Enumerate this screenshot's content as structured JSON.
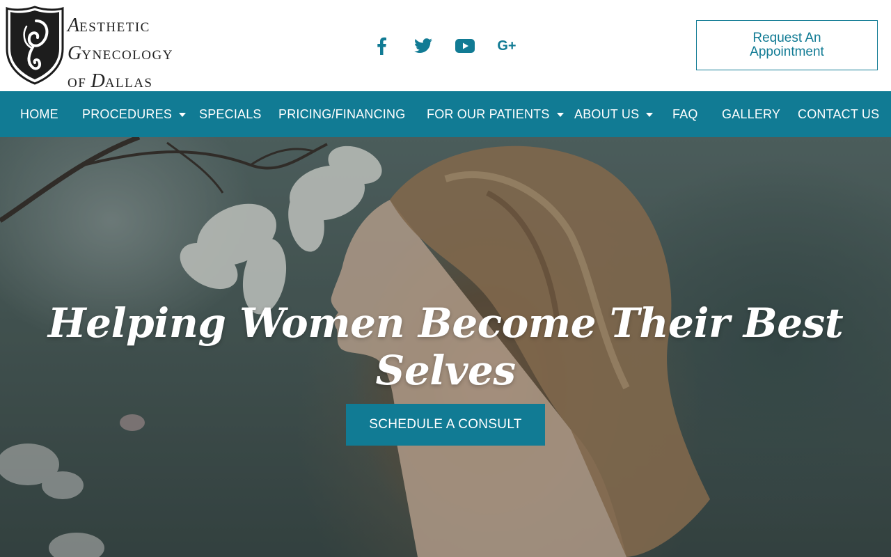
{
  "brand": {
    "logo": {
      "line1_cap": "A",
      "line1_rest": "ESTHETIC",
      "line2_cap": "G",
      "line2_rest": "YNECOLOGY",
      "line3_pre": "OF ",
      "line3_cap": "D",
      "line3_rest": "ALLAS"
    },
    "accent_color": "#117b94"
  },
  "social": [
    {
      "icon": "facebook-icon"
    },
    {
      "icon": "twitter-icon"
    },
    {
      "icon": "youtube-icon"
    },
    {
      "icon": "google-plus-icon",
      "glyph": "G+"
    }
  ],
  "header": {
    "request_line1": "Request An",
    "request_line2": "Appointment"
  },
  "nav": {
    "items": [
      {
        "label": "HOME",
        "dropdown": false
      },
      {
        "label": "PROCEDURES",
        "dropdown": true
      },
      {
        "label": "SPECIALS",
        "dropdown": false
      },
      {
        "label": "PRICING/FINANCING",
        "dropdown": false
      },
      {
        "label": "FOR OUR PATIENTS",
        "dropdown": true
      },
      {
        "label": "ABOUT US",
        "dropdown": true
      },
      {
        "label": "FAQ",
        "dropdown": false
      },
      {
        "label": "GALLERY",
        "dropdown": false
      },
      {
        "label": "CONTACT US",
        "dropdown": false
      }
    ]
  },
  "hero": {
    "title": "Helping Women Become Their Best Selves",
    "cta_label": "SCHEDULE A CONSULT"
  }
}
